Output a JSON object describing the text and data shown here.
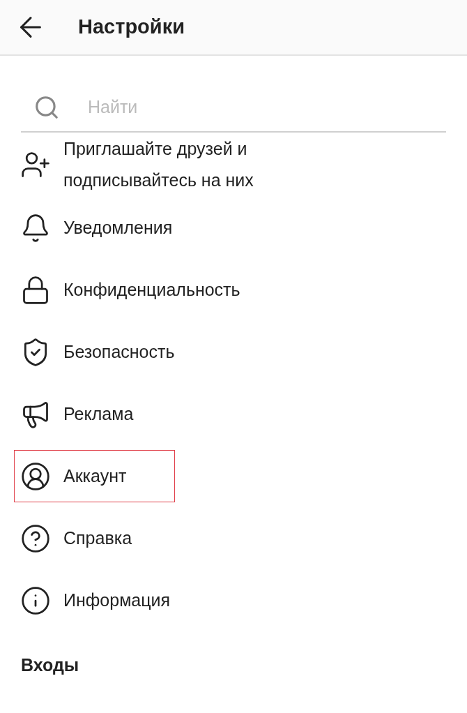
{
  "header": {
    "title": "Настройки"
  },
  "search": {
    "placeholder": "Найти"
  },
  "items": [
    {
      "kind": "invite",
      "label": "Приглашайте друзей и подписывайтесь на них",
      "highlighted": false
    },
    {
      "kind": "notifications",
      "label": "Уведомления",
      "highlighted": false
    },
    {
      "kind": "privacy",
      "label": "Конфиденциальность",
      "highlighted": false
    },
    {
      "kind": "security",
      "label": "Безопасность",
      "highlighted": false
    },
    {
      "kind": "ads",
      "label": "Реклама",
      "highlighted": false
    },
    {
      "kind": "account",
      "label": "Аккаунт",
      "highlighted": true
    },
    {
      "kind": "help",
      "label": "Справка",
      "highlighted": false
    },
    {
      "kind": "info",
      "label": "Информация",
      "highlighted": false
    }
  ],
  "section": {
    "title": "Входы"
  }
}
